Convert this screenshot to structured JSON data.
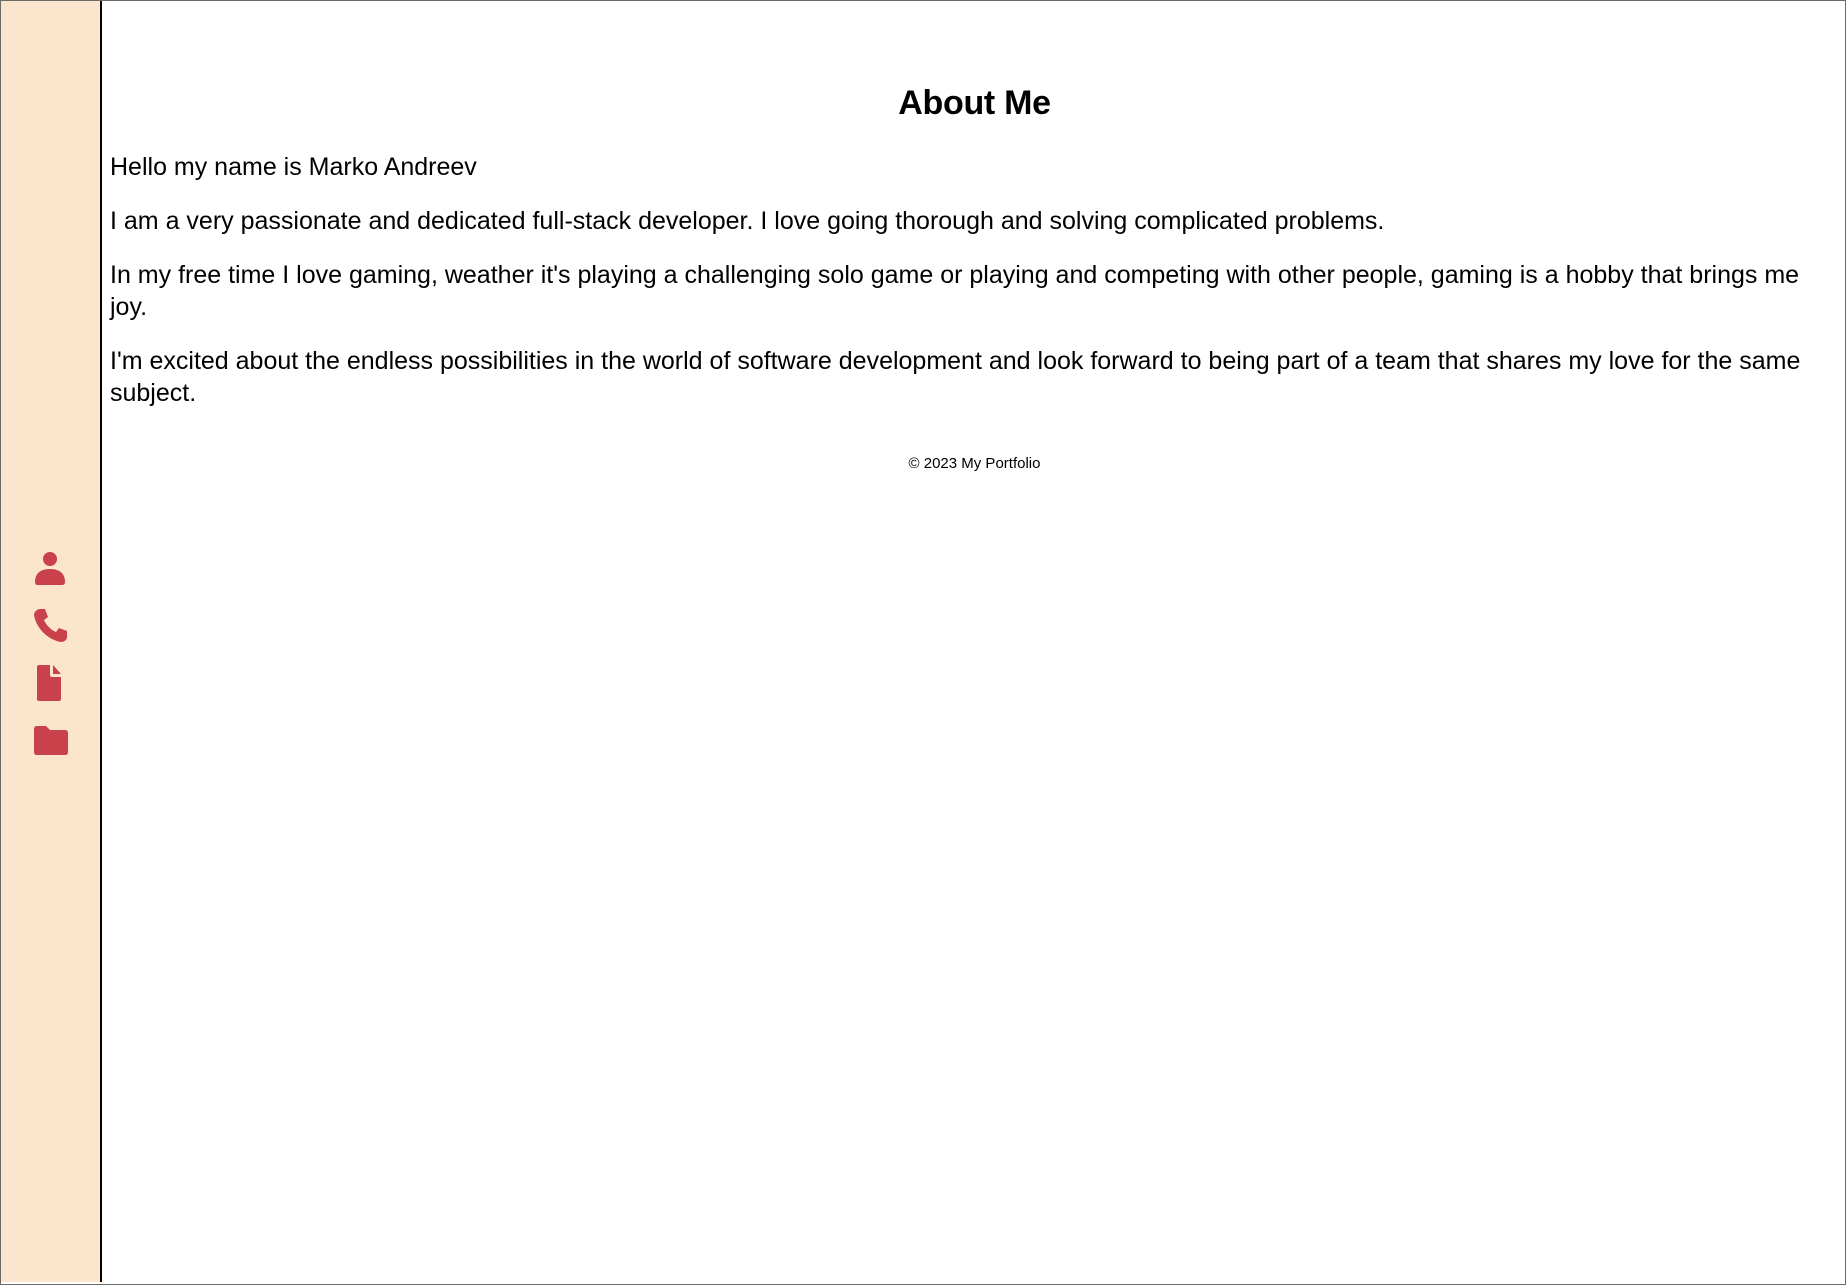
{
  "sidebar": {
    "background": "#fce5cd",
    "icon_color": "#c9414b",
    "items": [
      {
        "icon": "user-icon",
        "label": "About"
      },
      {
        "icon": "phone-icon",
        "label": "Contact"
      },
      {
        "icon": "file-icon",
        "label": "Resume"
      },
      {
        "icon": "folder-icon",
        "label": "Projects"
      }
    ]
  },
  "main": {
    "title": "About Me",
    "paragraphs": [
      "Hello my name is Marko Andreev",
      "I am a very passionate and dedicated full-stack developer. I love going thorough and solving complicated problems.",
      "In my free time I love gaming, weather it's playing a challenging solo game or playing and competing with other people, gaming is a hobby that brings me joy.",
      "I'm excited about the endless possibilities in the world of software development and look forward to being part of a team that shares my love for the same subject."
    ],
    "footer": "© 2023 My Portfolio"
  }
}
